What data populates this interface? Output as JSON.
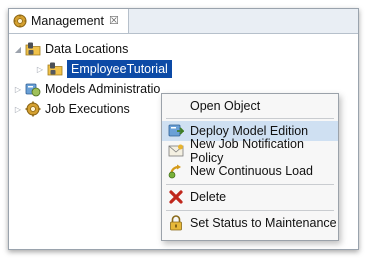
{
  "tab": {
    "title": "Management",
    "close_glyph": "☒"
  },
  "tree": {
    "items": [
      {
        "label": "Data Locations",
        "icon": "folder-db-icon"
      },
      {
        "label": "EmployeeTutorial",
        "icon": "folder-db-icon"
      },
      {
        "label": "Models Administratio",
        "icon": "models-icon"
      },
      {
        "label": "Job Executions",
        "icon": "gear-icon"
      }
    ]
  },
  "context_menu": {
    "items": [
      {
        "label": "Open Object",
        "icon": ""
      },
      {
        "label": "Deploy Model Edition",
        "icon": "deploy-icon"
      },
      {
        "label": "New Job Notification Policy",
        "icon": "envelope-icon"
      },
      {
        "label": "New Continuous Load",
        "icon": "continuous-load-icon"
      },
      {
        "label": "Delete",
        "icon": "delete-icon"
      },
      {
        "label": "Set Status to Maintenance",
        "icon": "lock-icon"
      }
    ]
  },
  "colors": {
    "selection": "#0c4aa6",
    "hover": "#cfe0f2",
    "delete_red": "#c0271c"
  }
}
